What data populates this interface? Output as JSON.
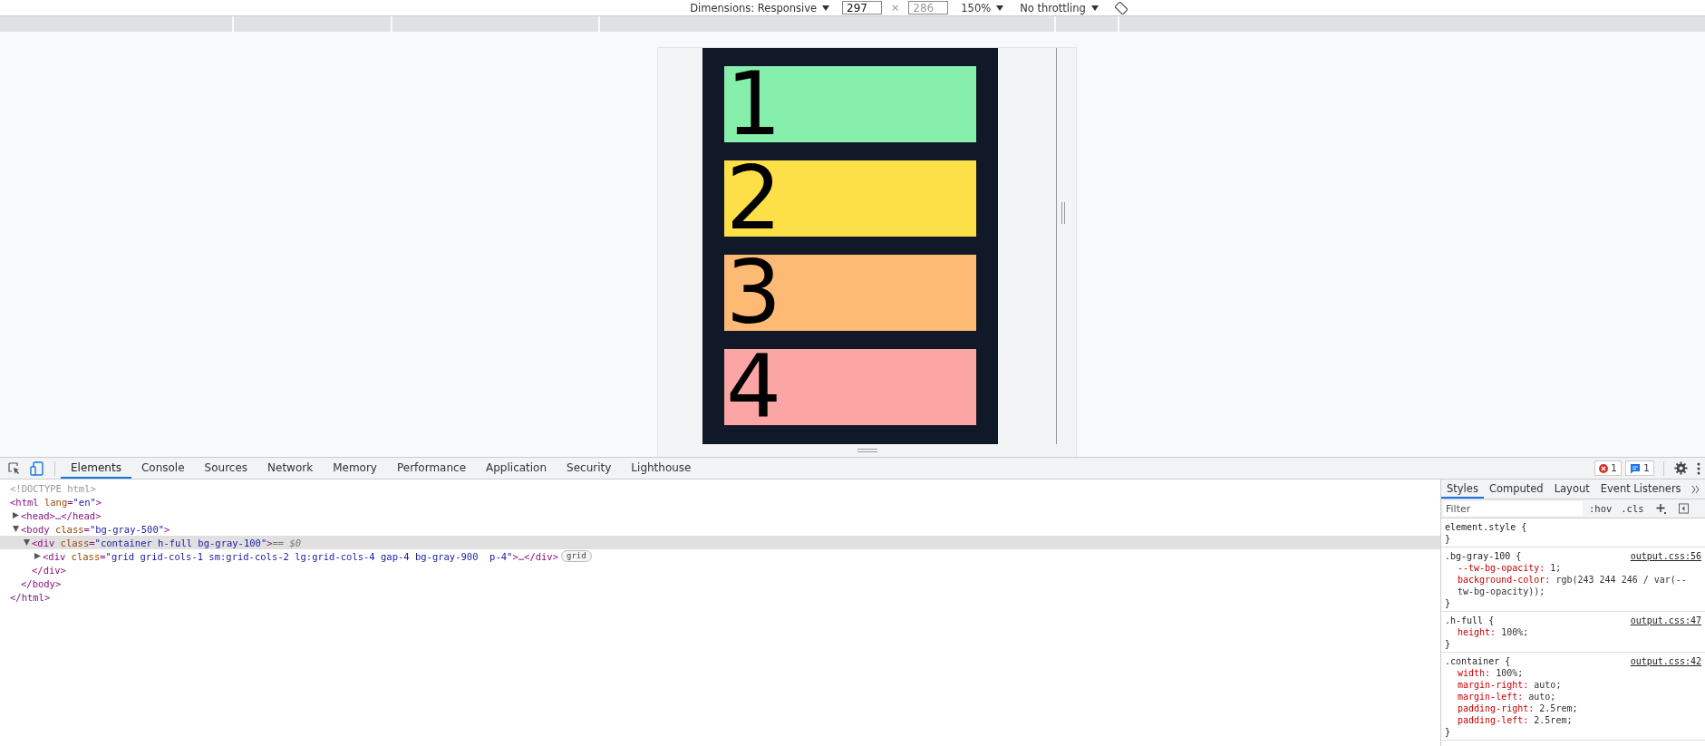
{
  "device_toolbar": {
    "dimensions_dropdown": "Dimensions: Responsive",
    "width_field": {
      "value": "297"
    },
    "times_sign": "×",
    "height_field": {
      "placeholder": "286"
    },
    "zoom_dropdown": "150%",
    "throttling_dropdown": "No throttling"
  },
  "viewport": {
    "cards": [
      {
        "label": "1",
        "color": "#86efac"
      },
      {
        "label": "2",
        "color": "#fde047"
      },
      {
        "label": "3",
        "color": "#fdba74"
      },
      {
        "label": "4",
        "color": "#fca5a5"
      }
    ]
  },
  "devtools": {
    "tabs": [
      {
        "label": "Elements",
        "selected": true
      },
      {
        "label": "Console",
        "selected": false
      },
      {
        "label": "Sources",
        "selected": false
      },
      {
        "label": "Network",
        "selected": false
      },
      {
        "label": "Memory",
        "selected": false
      },
      {
        "label": "Performance",
        "selected": false
      },
      {
        "label": "Application",
        "selected": false
      },
      {
        "label": "Security",
        "selected": false
      },
      {
        "label": "Lighthouse",
        "selected": false
      }
    ],
    "error_count": "1",
    "message_count": "1",
    "dom_tree": [
      {
        "kind": "doctype",
        "text": "<!DOCTYPE html>",
        "selected": false
      },
      {
        "kind": "element",
        "text": "<html lang=\"en\">",
        "selected": false,
        "close": "</html>",
        "children": [
          {
            "kind": "element",
            "text": "<head>…</head>",
            "expanded": false,
            "selected": false
          },
          {
            "kind": "element",
            "text": "<body class=\"bg-gray-500\">",
            "expanded": true,
            "selected": false,
            "close": "</body>",
            "children": [
              {
                "kind": "element",
                "text": "<div class=\"container h-full bg-gray-100\">",
                "suffix": "== $0",
                "expanded": true,
                "selected": true,
                "close": "</div>",
                "children": [
                  {
                    "kind": "element",
                    "text": "<div class=\"grid grid-cols-1 sm:grid-cols-2 lg:grid-cols-4 gap-4 bg-gray-900  p-4\">…</div>",
                    "expanded": false,
                    "selected": false,
                    "badge": "grid"
                  }
                ]
              }
            ]
          }
        ]
      }
    ],
    "styles_pane": {
      "tabs": [
        {
          "label": "Styles",
          "selected": true
        },
        {
          "label": "Computed",
          "selected": false
        },
        {
          "label": "Layout",
          "selected": false
        },
        {
          "label": "Event Listeners",
          "selected": false
        }
      ],
      "filter": {
        "placeholder": "Filter"
      },
      "hov": ":hov",
      "cls": ".cls",
      "rules": [
        {
          "selector": "element.style {",
          "end": "}"
        },
        {
          "selector": ".bg-gray-100 {",
          "source": "output.css:56",
          "props": [
            {
              "name": "--tw-bg-opacity:",
              "value": "1;"
            },
            {
              "name": "background-color:",
              "value": "rgb(243 244 246 / var(--tw-bg-opacity));"
            }
          ],
          "end": "}"
        },
        {
          "selector": ".h-full {",
          "source": "output.css:47",
          "props": [
            {
              "name": "height:",
              "value": "100%;"
            }
          ],
          "end": "}"
        },
        {
          "selector": ".container {",
          "source": "output.css:42",
          "props": [
            {
              "name": "width:",
              "value": "100%;"
            },
            {
              "name": "margin-right:",
              "value": "auto;"
            },
            {
              "name": "margin-left:",
              "value": "auto;"
            },
            {
              "name": "padding-right:",
              "value": "2.5rem;"
            },
            {
              "name": "padding-left:",
              "value": "2.5rem;"
            }
          ],
          "end": "}"
        }
      ]
    }
  }
}
